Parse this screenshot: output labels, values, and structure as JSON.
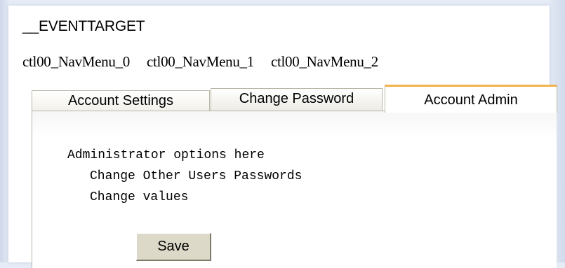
{
  "hidden_field": {
    "name": "__EVENTTARGET"
  },
  "nav_menu": {
    "items": [
      {
        "label": "ctl00_NavMenu_0"
      },
      {
        "label": "ctl00_NavMenu_1"
      },
      {
        "label": "ctl00_NavMenu_2"
      }
    ]
  },
  "tabs": [
    {
      "label": "Account Settings",
      "selected": false
    },
    {
      "label": "Change Password",
      "selected": false
    },
    {
      "label": "Account Admin",
      "selected": true
    }
  ],
  "panel": {
    "heading": "Administrator options here",
    "options": [
      "Change Other Users Passwords",
      "Change values"
    ],
    "save_label": "Save"
  },
  "colors": {
    "selected_tab_accent": "#f3b24a",
    "tab_border": "#b9b6a6",
    "button_face": "#ddd9c8",
    "page_background": "#e6ecf6"
  }
}
